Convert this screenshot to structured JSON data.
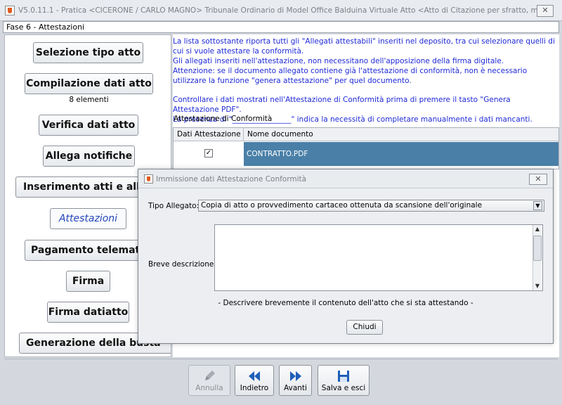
{
  "window": {
    "title": "V5.0.11.1 - Pratica <CICERONE / CARLO MAGNO>   Tribunale Ordinario di Model Office Balduina Virtuale   Atto <Atto di Citazione per sfratto, morosita', fine locazi...",
    "close_symbol": "✕"
  },
  "phase": {
    "label": "Fase 6 - Attestazioni"
  },
  "steps": [
    {
      "label": "Selezione tipo atto"
    },
    {
      "label": "Compilazione dati atto",
      "subtext": "8 elementi"
    },
    {
      "label": "Verifica dati atto"
    },
    {
      "label": "Allega notifiche"
    },
    {
      "label": "Inserimento atti e allegati"
    },
    {
      "label": "Attestazioni",
      "active": true
    },
    {
      "label": "Pagamento telematico"
    },
    {
      "label": "Firma"
    },
    {
      "label": "Firma datiatto"
    },
    {
      "label": "Generazione della busta"
    }
  ],
  "info": {
    "line1": "La lista sottostante riporta tutti gli \"Allegati attestabili\" inseriti nel deposito, tra cui selezionare quelli di cui si vuole attestare la conformità.",
    "line2": "Gli allegati inseriti nell'attestazione, non necessitano dell'apposizione della firma digitale.",
    "line3": "Attenzione: se il documento allegato contiene già l'attestazione di conformità, non è necessario utilizzare la funzione \"genera attestazione\" per quel documento.",
    "line4": "Controllare i dati mostrati nell'Attestazione di Conformità prima di premere il tasto \"Genera Attestazione PDF\".",
    "line5": "La presenza di \"________________\" indica la necessità di completare manualmente i dati mancanti."
  },
  "section_label": "Attestazione di Conformità",
  "table": {
    "columns": [
      "Dati Attestazione",
      "Nome documento"
    ],
    "rows": [
      {
        "checked": true,
        "check_symbol": "✓",
        "name": "CONTRATTO.PDF"
      }
    ]
  },
  "dialog": {
    "title": "Immissione dati Attestazione Conformità",
    "close_symbol": "✕",
    "type_label": "Tipo Allegato:",
    "type_value": "Copia di atto o provvedimento cartaceo ottenuta da scansione dell'originale",
    "description_label": "Breve descrizione:",
    "description_value": "",
    "hint": "- Descrivere brevemente il contenuto dell'atto che si sta attestando -",
    "close_button": "Chiudi"
  },
  "toolbar": {
    "cancel": "Annulla",
    "back": "Indietro",
    "forward": "Avanti",
    "save_exit": "Salva e esci"
  },
  "colors": {
    "info_text": "#1f2ad6",
    "selected_row": "#4a80a8",
    "active_step": "#2347b8",
    "toolbar_icon": "#1f5fb8"
  }
}
